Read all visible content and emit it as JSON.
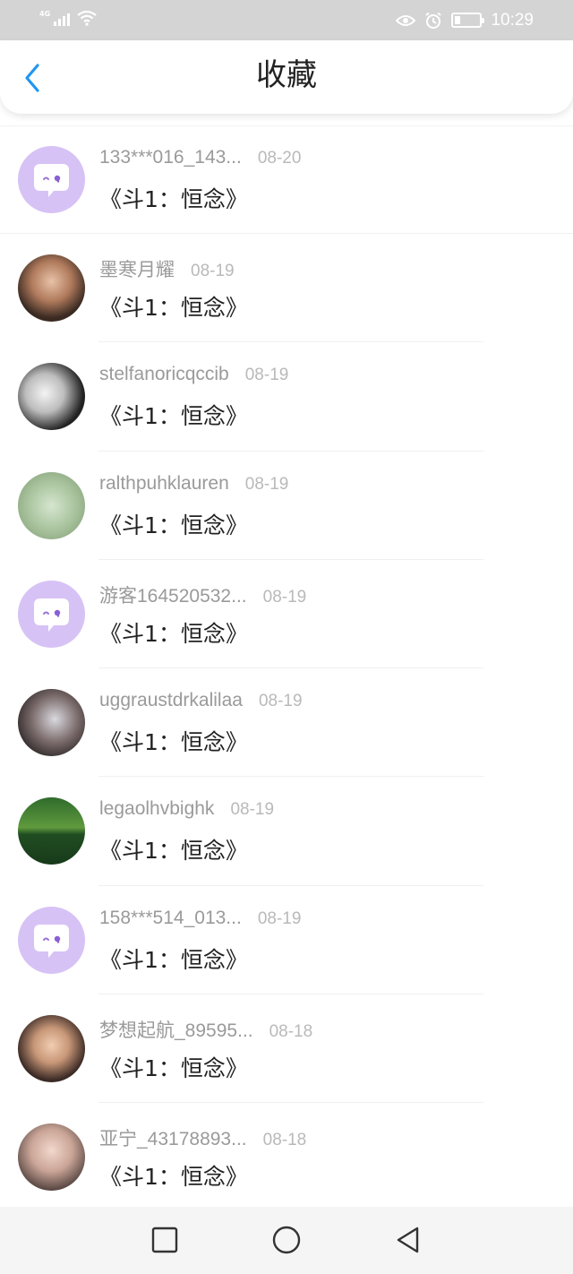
{
  "status_bar": {
    "network": "4G",
    "time": "10:29",
    "icons": [
      "signal-icon",
      "wifi-icon",
      "eye-icon",
      "alarm-icon",
      "battery-icon"
    ]
  },
  "header": {
    "back_icon": "chevron-left-icon",
    "title": "收藏",
    "accent_color": "#2196f3"
  },
  "favorites": [
    {
      "user": "133***016_143...",
      "date": "08-20",
      "title": "《斗1：恒念》",
      "avatar": "default-chat-avatar"
    },
    {
      "user": "墨寒月耀",
      "date": "08-19",
      "title": "《斗1：恒念》",
      "avatar": "photo-avatar"
    },
    {
      "user": "stelfanoricqccib",
      "date": "08-19",
      "title": "《斗1：恒念》",
      "avatar": "photo-avatar"
    },
    {
      "user": "ralthpuhklauren",
      "date": "08-19",
      "title": "《斗1：恒念》",
      "avatar": "photo-avatar"
    },
    {
      "user": "游客164520532...",
      "date": "08-19",
      "title": "《斗1：恒念》",
      "avatar": "default-chat-avatar"
    },
    {
      "user": "uggraustdrkalilaa",
      "date": "08-19",
      "title": "《斗1：恒念》",
      "avatar": "photo-avatar"
    },
    {
      "user": "legaolhvbighk",
      "date": "08-19",
      "title": "《斗1：恒念》",
      "avatar": "photo-avatar"
    },
    {
      "user": "158***514_013...",
      "date": "08-19",
      "title": "《斗1：恒念》",
      "avatar": "default-chat-avatar"
    },
    {
      "user": "梦想起航_89595...",
      "date": "08-18",
      "title": "《斗1：恒念》",
      "avatar": "photo-avatar"
    },
    {
      "user": "亚宁_43178893...",
      "date": "08-18",
      "title": "《斗1：恒念》",
      "avatar": "photo-avatar"
    }
  ],
  "nav_bar": {
    "buttons": [
      "recents-square-icon",
      "home-circle-icon",
      "back-triangle-icon"
    ]
  }
}
